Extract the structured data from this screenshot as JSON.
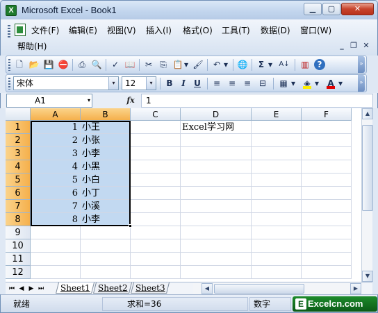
{
  "window": {
    "title": "Microsoft Excel - Book1",
    "app_icon": "excel-icon",
    "min_glyph": "▁",
    "max_glyph": "▢",
    "close_glyph": "✕"
  },
  "menu": {
    "items": [
      "文件(F)",
      "编辑(E)",
      "视图(V)",
      "插入(I)",
      "格式(O)",
      "工具(T)",
      "数据(D)",
      "窗口(W)",
      "帮助(H)"
    ],
    "mdi_min": "_",
    "mdi_restore": "❐",
    "mdi_close": "✕"
  },
  "standard_toolbar": {
    "icons": [
      "new-icon",
      "open-icon",
      "save-icon",
      "permission-icon",
      "print-icon",
      "print-preview-icon",
      "spelling-icon",
      "research-icon",
      "cut-icon",
      "copy-icon",
      "paste-icon",
      "format-painter-icon",
      "undo-icon",
      "hyperlink-icon",
      "autosum-icon",
      "sort-ascending-icon",
      "chart-wizard-icon",
      "help-icon"
    ],
    "glyphs": {
      "new": "🗋",
      "open": "📂",
      "save": "💾",
      "permission": "⛔",
      "print": "⎙",
      "preview": "🔍",
      "spelling": "✓",
      "research": "📖",
      "cut": "✂",
      "copy": "⎘",
      "paste": "📋",
      "painter": "🖌",
      "undo": "↶",
      "hyperlink": "🌐",
      "autosum": "Σ",
      "sort": "A↓",
      "chart": "▥",
      "help": "?",
      "dropdown": "▾",
      "chevron": "»"
    }
  },
  "format_toolbar": {
    "font_name": "宋体",
    "font_size": "12",
    "bold": "B",
    "italic": "I",
    "underline": "U",
    "align_left": "≡",
    "align_center": "≡",
    "align_right": "≡",
    "merge_center": "⊟",
    "borders": "▦",
    "fill_color": "◈",
    "font_color": "A",
    "dropdown": "▾",
    "chevron": "»",
    "fill_color_value": "#ffef00",
    "font_color_value": "#e00000"
  },
  "formula_bar": {
    "name_box": "A1",
    "name_box_dropdown": "▾",
    "fx": "fx",
    "value": "1"
  },
  "sheet": {
    "columns": [
      "A",
      "B",
      "C",
      "D",
      "E",
      "F"
    ],
    "rows": [
      "1",
      "2",
      "3",
      "4",
      "5",
      "6",
      "7",
      "8",
      "9",
      "10",
      "11",
      "12"
    ],
    "column_a": [
      "1",
      "2",
      "3",
      "4",
      "5",
      "6",
      "7",
      "8"
    ],
    "column_b": [
      "小王",
      "小张",
      "小李",
      "小黑",
      "小白",
      "小丁",
      "小溪",
      "小李"
    ],
    "d1": "Excel学习网",
    "selected_range": "A1:B8"
  },
  "tabs": {
    "nav": [
      "⏮",
      "◀",
      "▶",
      "⏭"
    ],
    "sheets": [
      "Sheet1",
      "Sheet2",
      "Sheet3"
    ],
    "active": "Sheet1",
    "scroll_left": "◀",
    "scroll_right": "▶"
  },
  "scrollbar": {
    "up": "▲",
    "down": "▼"
  },
  "status": {
    "ready": "就绪",
    "sum": "求和=36",
    "num_lock": "数字"
  },
  "brand": {
    "mark": "E",
    "text": "Excelcn.com"
  },
  "colors": {
    "selection_fill": "#c2d9f1",
    "header_selected": "#f5b04c",
    "brand_green": "#0b5b17"
  }
}
